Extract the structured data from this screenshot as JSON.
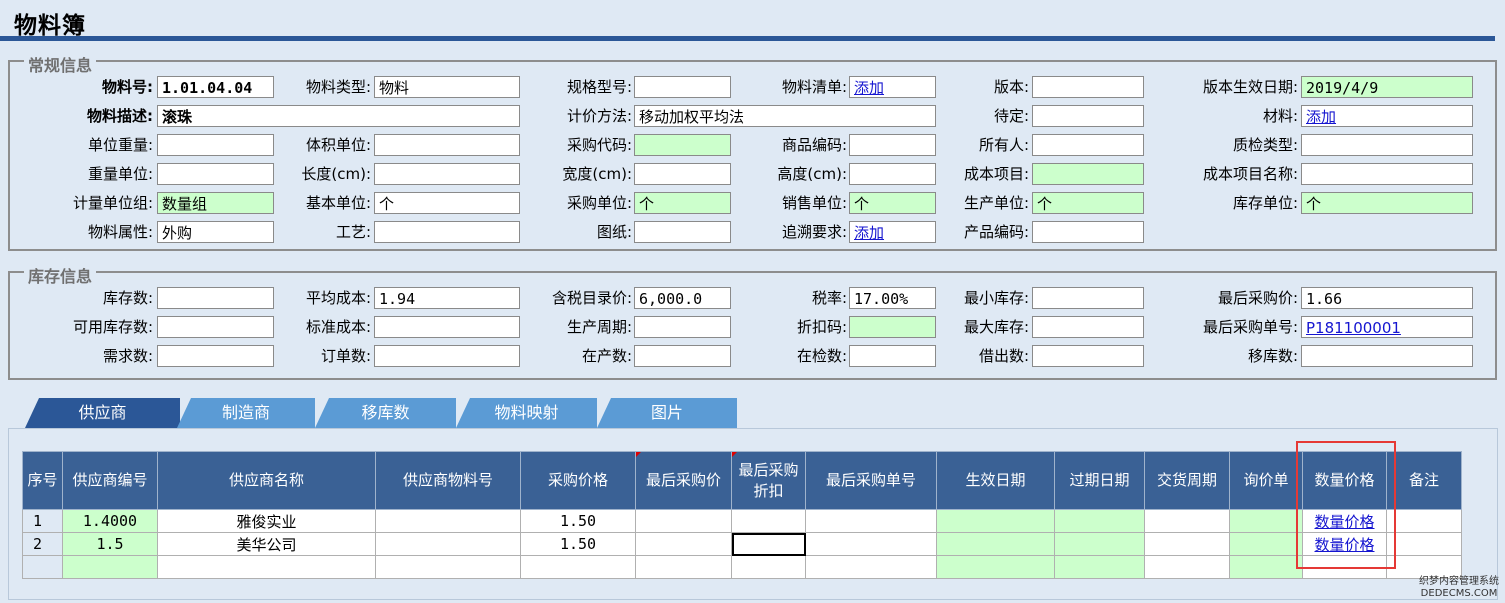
{
  "title": "物料簿",
  "general": {
    "legend": "常规信息",
    "rows": [
      [
        {
          "label": "物料号:",
          "value": "1.01.04.04",
          "bold": true
        },
        {
          "label": "物料类型:",
          "value": "物料"
        },
        {
          "label": "规格型号:",
          "value": ""
        },
        {
          "label": "物料清单:",
          "value": "添加",
          "link": true
        },
        {
          "label": "版本:",
          "value": ""
        },
        {
          "label": "版本生效日期:",
          "value": "2019/4/9",
          "green": true
        }
      ],
      [
        {
          "label": "物料描述:",
          "value": "滚珠",
          "bold": true
        },
        {
          "label": "计价方法:",
          "value": "移动加权平均法"
        },
        {
          "label": "待定:",
          "value": ""
        },
        {
          "label": "材料:",
          "value": "添加",
          "link": true
        }
      ],
      [
        {
          "label": "单位重量:",
          "value": ""
        },
        {
          "label": "体积单位:",
          "value": ""
        },
        {
          "label": "采购代码:",
          "value": "",
          "green": true
        },
        {
          "label": "商品编码:",
          "value": ""
        },
        {
          "label": "所有人:",
          "value": ""
        },
        {
          "label": "质检类型:",
          "value": ""
        }
      ],
      [
        {
          "label": "重量单位:",
          "value": ""
        },
        {
          "label": "长度(cm):",
          "value": ""
        },
        {
          "label": "宽度(cm):",
          "value": ""
        },
        {
          "label": "高度(cm):",
          "value": ""
        },
        {
          "label": "成本项目:",
          "value": "",
          "green": true
        },
        {
          "label": "成本项目名称:",
          "value": ""
        }
      ],
      [
        {
          "label": "计量单位组:",
          "value": "数量组",
          "green": true
        },
        {
          "label": "基本单位:",
          "value": "个"
        },
        {
          "label": "采购单位:",
          "value": "个",
          "green": true
        },
        {
          "label": "销售单位:",
          "value": "个",
          "green": true
        },
        {
          "label": "生产单位:",
          "value": "个",
          "green": true
        },
        {
          "label": "库存单位:",
          "value": "个",
          "green": true
        }
      ],
      [
        {
          "label": "物料属性:",
          "value": "外购"
        },
        {
          "label": "工艺:",
          "value": ""
        },
        {
          "label": "图纸:",
          "value": ""
        },
        {
          "label": "追溯要求:",
          "value": "添加",
          "link": true
        },
        {
          "label": "产品编码:",
          "value": ""
        }
      ]
    ]
  },
  "stock": {
    "legend": "库存信息",
    "rows": [
      [
        {
          "label": "库存数:",
          "value": ""
        },
        {
          "label": "平均成本:",
          "value": "1.94"
        },
        {
          "label": "含税目录价:",
          "value": "6,000.0"
        },
        {
          "label": "税率:",
          "value": "17.00%"
        },
        {
          "label": "最小库存:",
          "value": ""
        },
        {
          "label": "最后采购价:",
          "value": "1.66"
        }
      ],
      [
        {
          "label": "可用库存数:",
          "value": ""
        },
        {
          "label": "标准成本:",
          "value": ""
        },
        {
          "label": "生产周期:",
          "value": ""
        },
        {
          "label": "折扣码:",
          "value": "",
          "green": true
        },
        {
          "label": "最大库存:",
          "value": ""
        },
        {
          "label": "最后采购单号:",
          "value": "P181100001",
          "link": true
        }
      ],
      [
        {
          "label": "需求数:",
          "value": ""
        },
        {
          "label": "订单数:",
          "value": ""
        },
        {
          "label": "在产数:",
          "value": ""
        },
        {
          "label": "在检数:",
          "value": ""
        },
        {
          "label": "借出数:",
          "value": ""
        },
        {
          "label": "移库数:",
          "value": ""
        }
      ]
    ]
  },
  "tabs": [
    "供应商",
    "制造商",
    "移库数",
    "物料映射",
    "图片"
  ],
  "supplier_table": {
    "headers": [
      "序号",
      "供应商编号",
      "供应商名称",
      "供应商物料号",
      "采购价格",
      "最后采购价",
      "最后采购折扣",
      "最后采购单号",
      "生效日期",
      "过期日期",
      "交货周期",
      "询价单",
      "数量价格",
      "备注"
    ],
    "rows": [
      [
        "1",
        "1.4000",
        "雅俊实业",
        "",
        "1.50",
        "",
        "",
        "",
        "",
        "",
        "",
        "",
        "数量价格",
        ""
      ],
      [
        "2",
        "1.5",
        "美华公司",
        "",
        "1.50",
        "",
        "",
        "",
        "",
        "",
        "",
        "",
        "数量价格",
        ""
      ]
    ]
  },
  "watermark": [
    "织梦内容管理系统",
    "DEDECMS.COM"
  ]
}
